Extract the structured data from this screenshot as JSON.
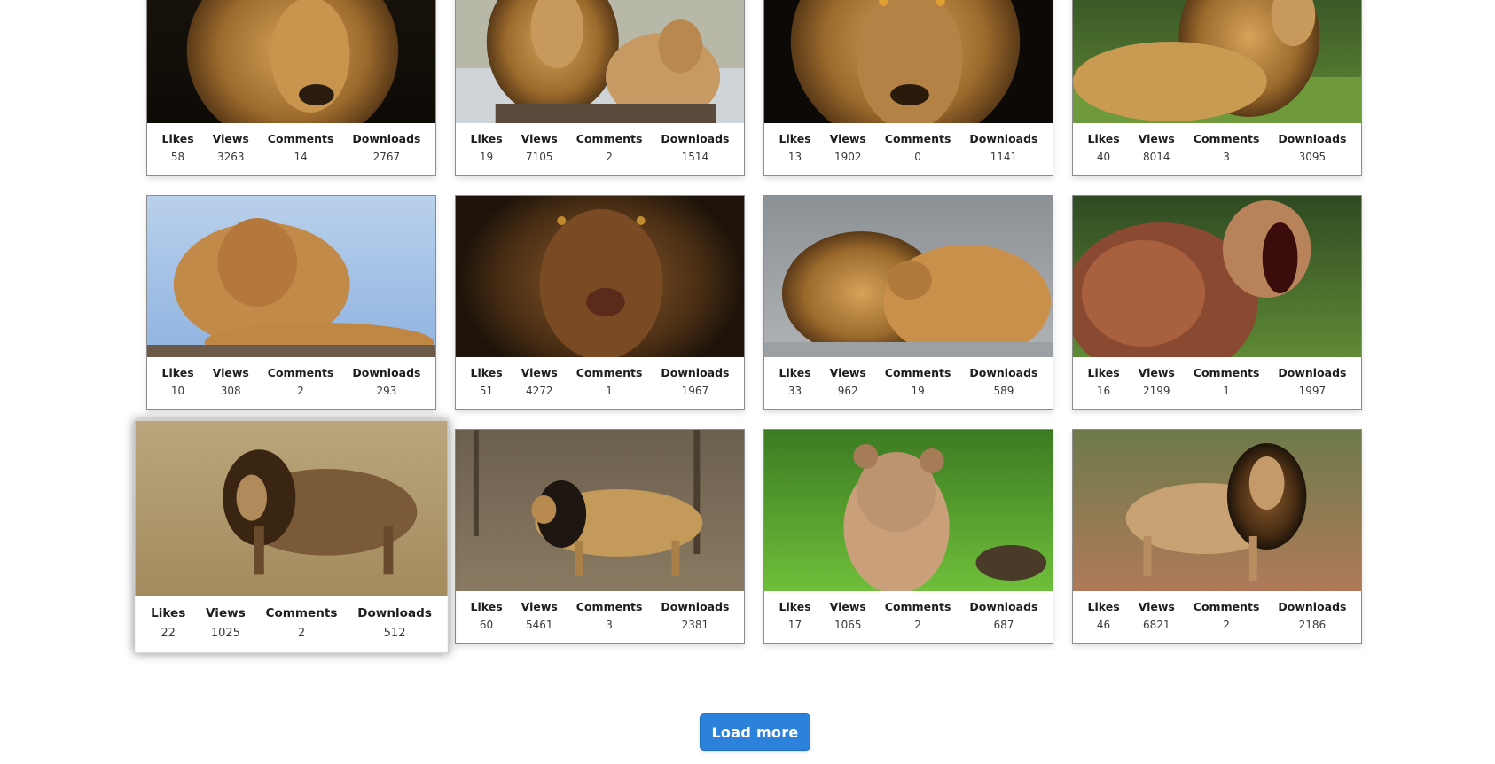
{
  "gallery": {
    "labels": {
      "likes": "Likes",
      "views": "Views",
      "comments": "Comments",
      "downloads": "Downloads"
    },
    "cards": [
      {
        "likes": "58",
        "views": "3263",
        "comments": "14",
        "downloads": "2767"
      },
      {
        "likes": "19",
        "views": "7105",
        "comments": "2",
        "downloads": "1514"
      },
      {
        "likes": "13",
        "views": "1902",
        "comments": "0",
        "downloads": "1141"
      },
      {
        "likes": "40",
        "views": "8014",
        "comments": "3",
        "downloads": "3095"
      },
      {
        "likes": "10",
        "views": "308",
        "comments": "2",
        "downloads": "293"
      },
      {
        "likes": "51",
        "views": "4272",
        "comments": "1",
        "downloads": "1967"
      },
      {
        "likes": "33",
        "views": "962",
        "comments": "19",
        "downloads": "589"
      },
      {
        "likes": "16",
        "views": "2199",
        "comments": "1",
        "downloads": "1997"
      },
      {
        "likes": "22",
        "views": "1025",
        "comments": "2",
        "downloads": "512"
      },
      {
        "likes": "60",
        "views": "5461",
        "comments": "3",
        "downloads": "2381"
      },
      {
        "likes": "17",
        "views": "1065",
        "comments": "2",
        "downloads": "687"
      },
      {
        "likes": "46",
        "views": "6821",
        "comments": "2",
        "downloads": "2186"
      }
    ]
  },
  "load_more_label": "Load more",
  "colors": {
    "button_bg": "#2c82db",
    "card_border": "#8d8d8d"
  }
}
